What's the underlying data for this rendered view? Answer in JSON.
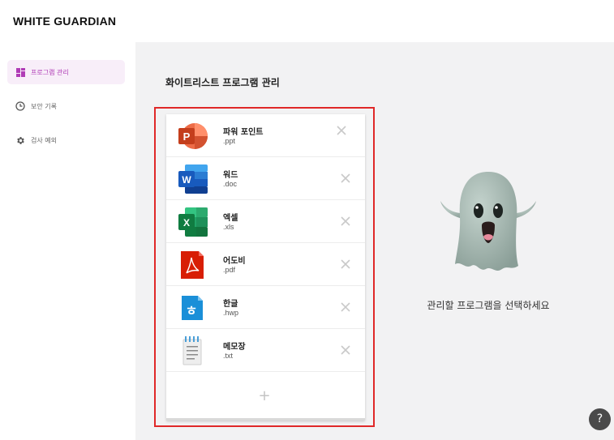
{
  "app": {
    "title": "WHITE GUARDIAN"
  },
  "sidebar": {
    "items": [
      {
        "label": "프로그램 관리",
        "icon": "dashboard-icon",
        "active": true
      },
      {
        "label": "보안 기록",
        "icon": "clock-icon",
        "active": false
      },
      {
        "label": "검사 예외",
        "icon": "gear-icon",
        "active": false
      }
    ]
  },
  "main": {
    "title": "화이트리스트 프로그램 관리",
    "empty_message": "관리할 프로그램을 선택하세요"
  },
  "programs": [
    {
      "name": "파워 포인트",
      "ext": ".ppt",
      "icon": "powerpoint-icon"
    },
    {
      "name": "워드",
      "ext": ".doc",
      "icon": "word-icon"
    },
    {
      "name": "엑셀",
      "ext": ".xls",
      "icon": "excel-icon"
    },
    {
      "name": "어도비",
      "ext": ".pdf",
      "icon": "adobe-pdf-icon"
    },
    {
      "name": "한글",
      "ext": ".hwp",
      "icon": "hangul-icon"
    },
    {
      "name": "메모장",
      "ext": ".txt",
      "icon": "notepad-icon"
    }
  ],
  "add_label": "+",
  "help_label": "?",
  "colors": {
    "accent": "#b03cb6",
    "highlight_border": "#e02828",
    "background": "#f2f2f3"
  }
}
